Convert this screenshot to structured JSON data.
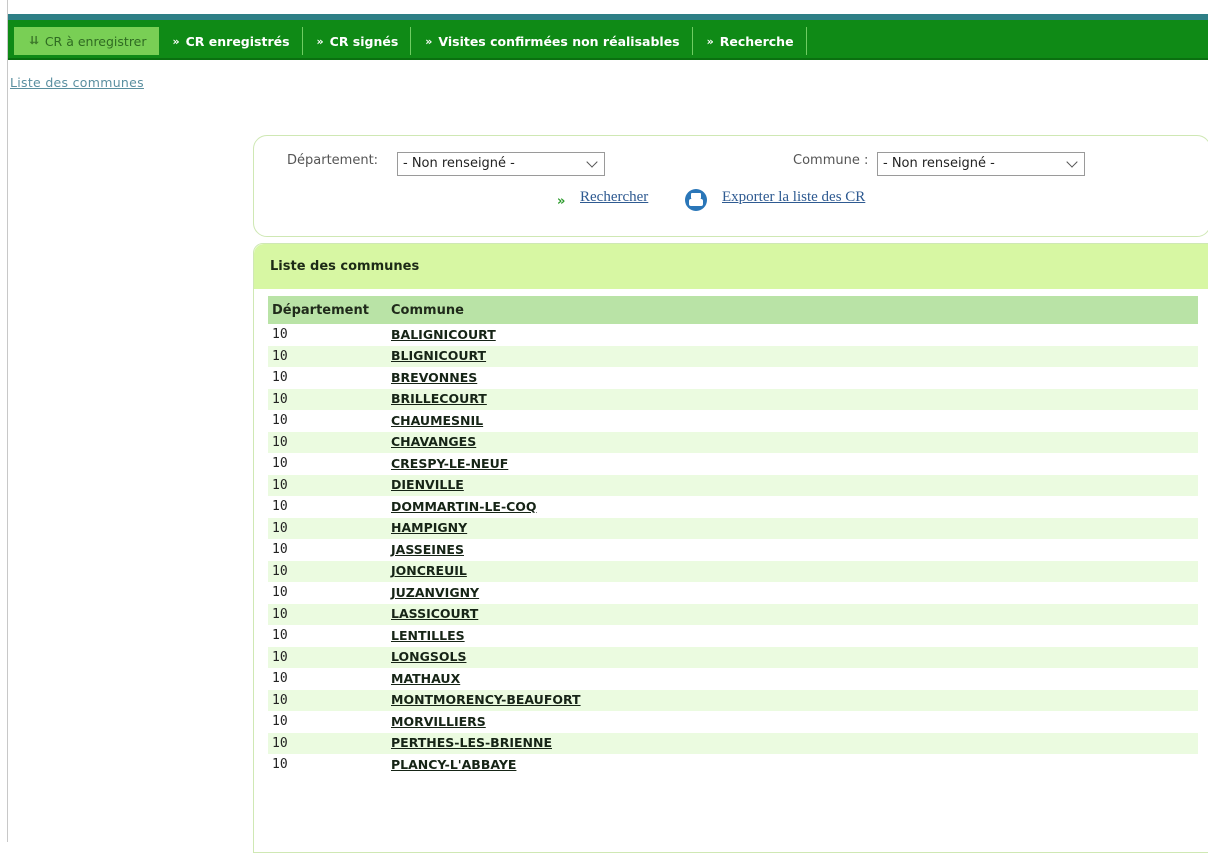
{
  "nav": {
    "tabs": [
      {
        "label": "CR à enregistrer",
        "active": true
      },
      {
        "label": "CR enregistrés"
      },
      {
        "label": "CR signés"
      },
      {
        "label": "Visites confirmées non réalisables"
      },
      {
        "label": "Recherche"
      }
    ]
  },
  "breadcrumb": "Liste des communes",
  "search": {
    "departement_label": "Département:",
    "departement_value": "- Non renseigné -",
    "commune_label": "Commune :",
    "commune_value": "- Non renseigné -",
    "search_link": "Rechercher",
    "export_link": "Exporter la liste des CR"
  },
  "list": {
    "title": "Liste des communes",
    "columns": [
      "Département",
      "Commune"
    ],
    "rows": [
      {
        "dept": "10",
        "commune": "BALIGNICOURT"
      },
      {
        "dept": "10",
        "commune": "BLIGNICOURT"
      },
      {
        "dept": "10",
        "commune": "BREVONNES"
      },
      {
        "dept": "10",
        "commune": "BRILLECOURT"
      },
      {
        "dept": "10",
        "commune": "CHAUMESNIL"
      },
      {
        "dept": "10",
        "commune": "CHAVANGES"
      },
      {
        "dept": "10",
        "commune": "CRESPY-LE-NEUF"
      },
      {
        "dept": "10",
        "commune": "DIENVILLE"
      },
      {
        "dept": "10",
        "commune": "DOMMARTIN-LE-COQ"
      },
      {
        "dept": "10",
        "commune": "HAMPIGNY"
      },
      {
        "dept": "10",
        "commune": "JASSEINES"
      },
      {
        "dept": "10",
        "commune": "JONCREUIL"
      },
      {
        "dept": "10",
        "commune": "JUZANVIGNY"
      },
      {
        "dept": "10",
        "commune": "LASSICOURT"
      },
      {
        "dept": "10",
        "commune": "LENTILLES"
      },
      {
        "dept": "10",
        "commune": "LONGSOLS"
      },
      {
        "dept": "10",
        "commune": "MATHAUX"
      },
      {
        "dept": "10",
        "commune": "MONTMORENCY-BEAUFORT"
      },
      {
        "dept": "10",
        "commune": "MORVILLIERS"
      },
      {
        "dept": "10",
        "commune": "PERTHES-LES-BRIENNE"
      },
      {
        "dept": "10",
        "commune": "PLANCY-L'ABBAYE"
      }
    ]
  }
}
